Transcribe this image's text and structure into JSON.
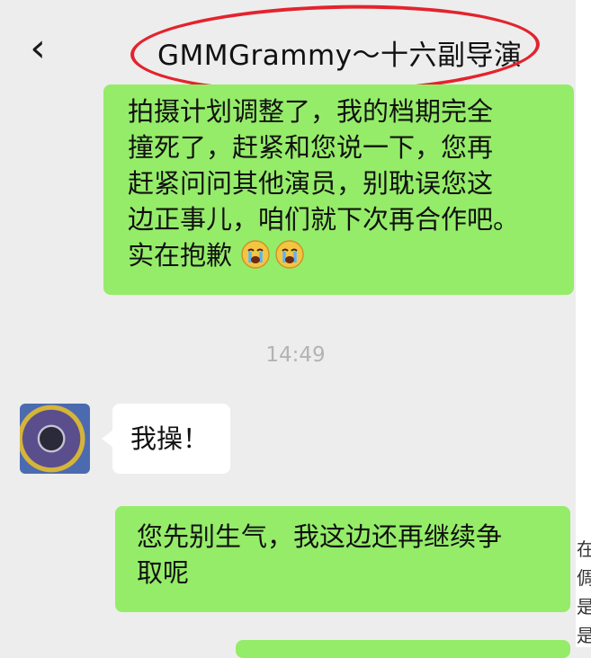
{
  "header": {
    "back_glyph": "‹",
    "title": "GMMGrammy～十六副导演"
  },
  "messages": [
    {
      "side": "right",
      "lines": [
        "拍摄计划调整了，我的档期完全",
        "撞死了，赶紧和您说一下，您再",
        "赶紧问问其他演员，别耽误您这",
        "边正事儿，咱们就下次再合作吧。",
        "实在抱歉"
      ],
      "emoji": [
        "crying-face",
        "crying-face"
      ]
    },
    {
      "timestamp": "14:49"
    },
    {
      "side": "left",
      "lines": [
        "我操！"
      ]
    },
    {
      "side": "right",
      "lines": [
        "您先别生气，我这边还再继续争",
        "取呢"
      ]
    }
  ],
  "edge_text": [
    "在",
    "倜",
    "是",
    "是"
  ],
  "colors": {
    "background": "#ededed",
    "outgoing_bubble": "#95ec69",
    "incoming_bubble": "#ffffff",
    "highlight_circle": "#e3232d",
    "timestamp": "#b3b3b3"
  }
}
